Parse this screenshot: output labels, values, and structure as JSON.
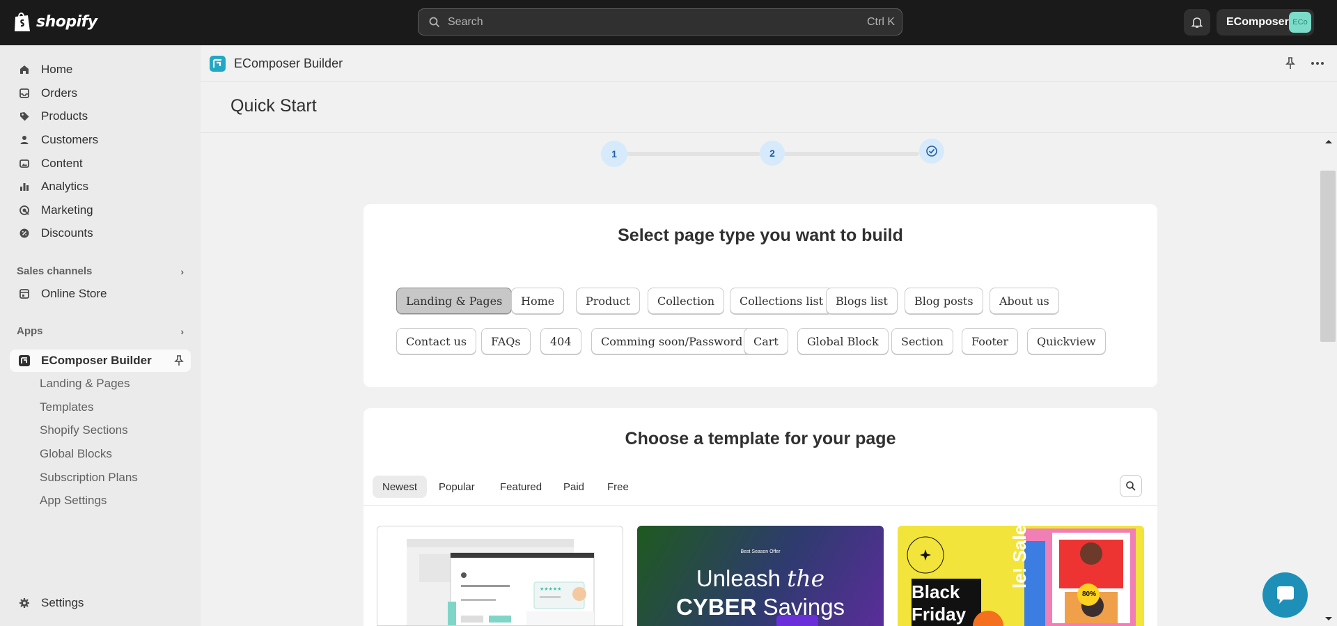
{
  "topbar": {
    "brand": "shopify",
    "search_placeholder": "Search",
    "search_shortcut": "Ctrl K",
    "account_name": "EComposer",
    "avatar_text": "ECo"
  },
  "sidebar": {
    "items": [
      {
        "label": "Home",
        "icon": "home-icon"
      },
      {
        "label": "Orders",
        "icon": "orders-icon"
      },
      {
        "label": "Products",
        "icon": "tag-icon"
      },
      {
        "label": "Customers",
        "icon": "person-icon"
      },
      {
        "label": "Content",
        "icon": "content-icon"
      },
      {
        "label": "Analytics",
        "icon": "bar-chart-icon"
      },
      {
        "label": "Marketing",
        "icon": "target-icon"
      },
      {
        "label": "Discounts",
        "icon": "discount-icon"
      }
    ],
    "sales_channels_label": "Sales channels",
    "online_store_label": "Online Store",
    "apps_label": "Apps",
    "active_app": "EComposer Builder",
    "app_sub_items": [
      "Landing & Pages",
      "Templates",
      "Shopify Sections",
      "Global Blocks",
      "Subscription Plans",
      "App Settings"
    ],
    "settings_label": "Settings"
  },
  "main": {
    "app_title": "EComposer Builder",
    "page_title": "Quick Start",
    "steps": [
      "1",
      "2"
    ],
    "select_card": {
      "title": "Select page type you want to build",
      "row1": [
        "Landing & Pages",
        "Home",
        "Product",
        "Collection",
        "Collections list",
        "Blogs list",
        "Blog posts",
        "About us"
      ],
      "row2": [
        "Contact us",
        "FAQs",
        "404",
        "Comming soon/Password",
        "Cart",
        "Global Block",
        "Section",
        "Footer",
        "Quickview"
      ],
      "active": "Landing & Pages"
    },
    "template_card": {
      "title": "Choose a template for your page",
      "tabs": [
        "Newest",
        "Popular",
        "Featured",
        "Paid",
        "Free"
      ],
      "active_tab": "Newest",
      "previews": {
        "cyber_small": "Best Season Offer",
        "cyber_line1": "Unleash",
        "cyber_the": "the",
        "cyber_line2a": "CYBER",
        "cyber_line2b": "Savings",
        "bf_line1": "Black",
        "bf_line2": "Friday",
        "bf_side": "le! Sale!",
        "bf_badge": "80%"
      }
    }
  },
  "colors": {
    "topbar": "#1a1a1a",
    "accent_blue": "#1f5fa6",
    "chat_button": "#1e90b8"
  }
}
